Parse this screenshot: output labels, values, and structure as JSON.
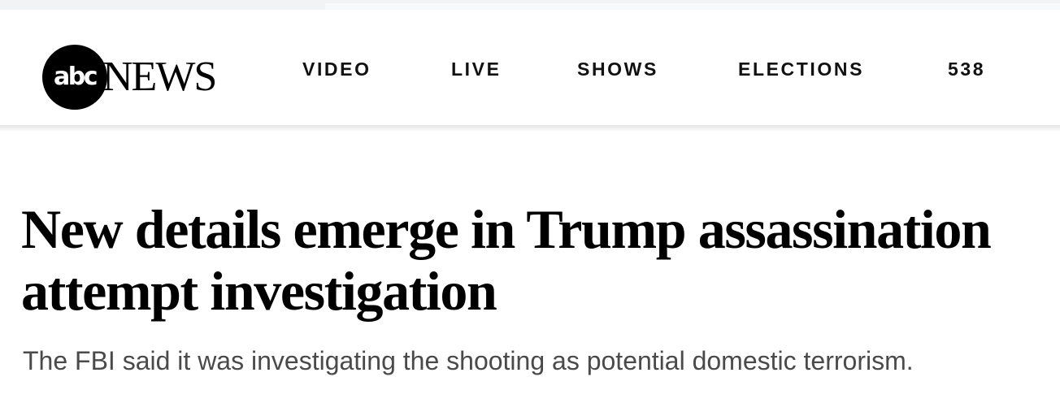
{
  "header": {
    "logo": {
      "badge_text": "abc",
      "wordmark": "NEWS"
    },
    "nav": [
      {
        "label": "VIDEO"
      },
      {
        "label": "LIVE"
      },
      {
        "label": "SHOWS"
      },
      {
        "label": "ELECTIONS"
      },
      {
        "label": "538"
      }
    ]
  },
  "article": {
    "headline": "New details emerge in Trump assassination attempt investigation",
    "dek": "The FBI said it was investigating the shooting as potential domestic terrorism."
  },
  "colors": {
    "logo_background": "#000000",
    "headline_text": "#000000",
    "dek_text": "#4a4a4a"
  }
}
